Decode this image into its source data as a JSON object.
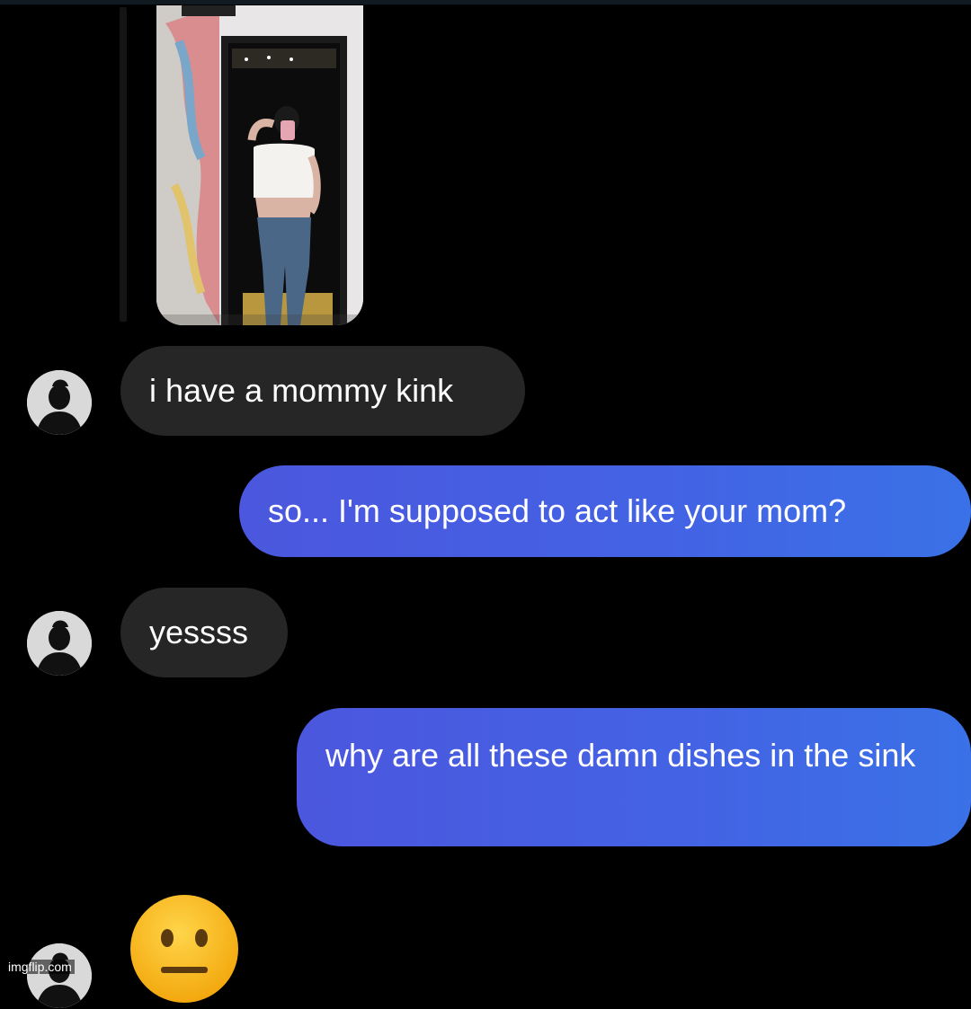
{
  "messages": [
    {
      "from": "them",
      "text": "i have a mommy kink"
    },
    {
      "from": "me",
      "text": "so... I'm supposed to act like your mom?"
    },
    {
      "from": "them",
      "text": "yessss"
    },
    {
      "from": "me",
      "text": "why are all these damn dishes in the sink"
    }
  ],
  "reaction_emoji": "neutral-face-emoji",
  "watermark": "imgflip.com",
  "colors": {
    "background": "#000000",
    "incoming_bubble": "#262626",
    "outgoing_bubble_start": "#4b57de",
    "outgoing_bubble_end": "#3a71e7",
    "text": "#ffffff"
  }
}
